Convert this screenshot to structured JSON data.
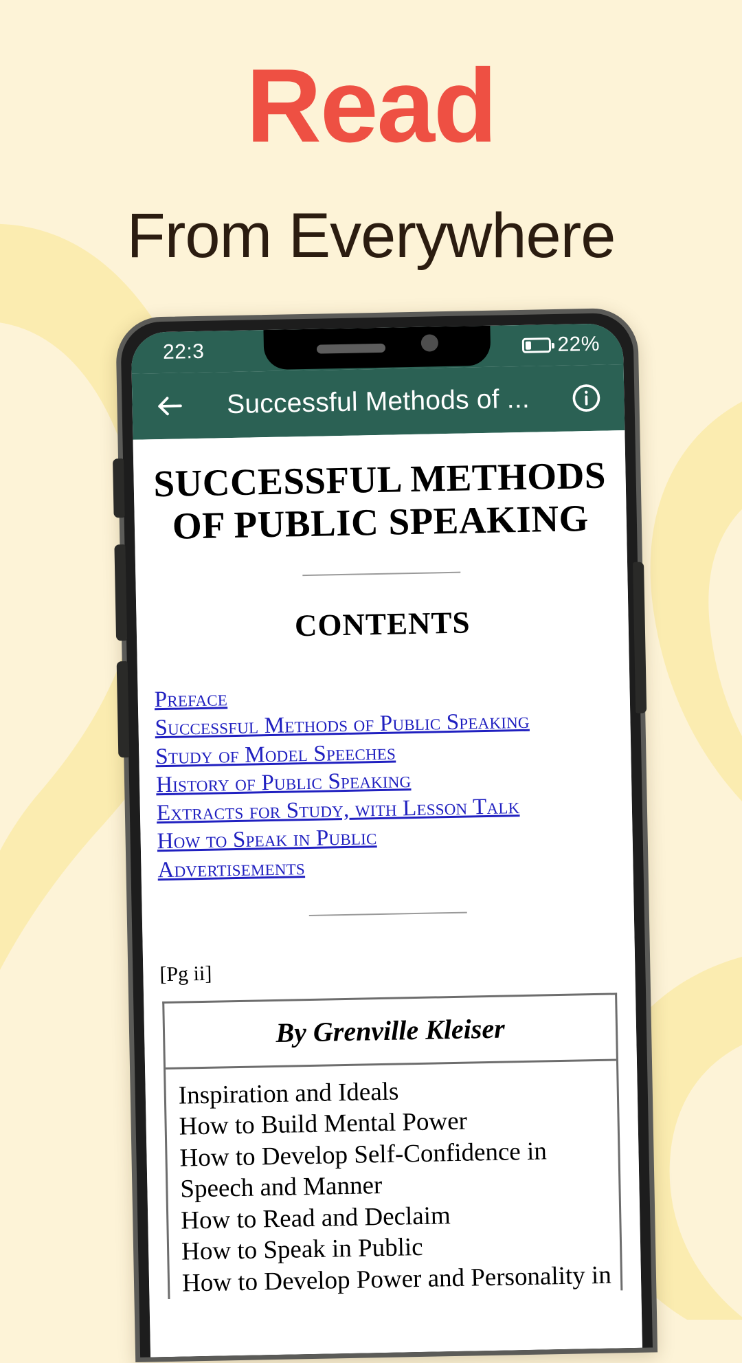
{
  "promo": {
    "headline": "Read",
    "subhead": "From Everywhere",
    "headline_color": "#ee5043",
    "subhead_color": "#2b1c10",
    "background_color": "#fdf3d7",
    "swoosh_color": "#fbecb0"
  },
  "phone": {
    "status_bar": {
      "time": "22:3",
      "battery_percent": "22%",
      "battery_level": 22,
      "background_color": "#2b6154",
      "speaker_icon": "speaker-grille-icon",
      "camera_icon": "front-camera-icon"
    },
    "app_bar": {
      "back_icon": "back-arrow-icon",
      "title": "Successful Methods of ...",
      "info_icon": "info-circle-icon",
      "background_color": "#2b6154"
    }
  },
  "book": {
    "title": "SUCCESSFUL METHODS OF PUBLIC SPEAKING",
    "contents_heading": "CONTENTS",
    "toc": [
      "Preface",
      "Successful Methods of Public Speaking",
      "Study of Model Speeches",
      "History of Public Speaking",
      "Extracts for Study, with Lesson Talk",
      "How to Speak in Public",
      "Advertisements"
    ],
    "link_color": "#2020c0",
    "page_marker": "[Pg ii]",
    "table": {
      "header": "By Grenville Kleiser",
      "items": [
        "Inspiration and Ideals",
        "How to Build Mental Power",
        "How to Develop Self-Confidence in Speech and Manner",
        "How to Read and Declaim",
        "How to Speak in Public",
        "How to Develop Power and Personality in"
      ]
    }
  }
}
